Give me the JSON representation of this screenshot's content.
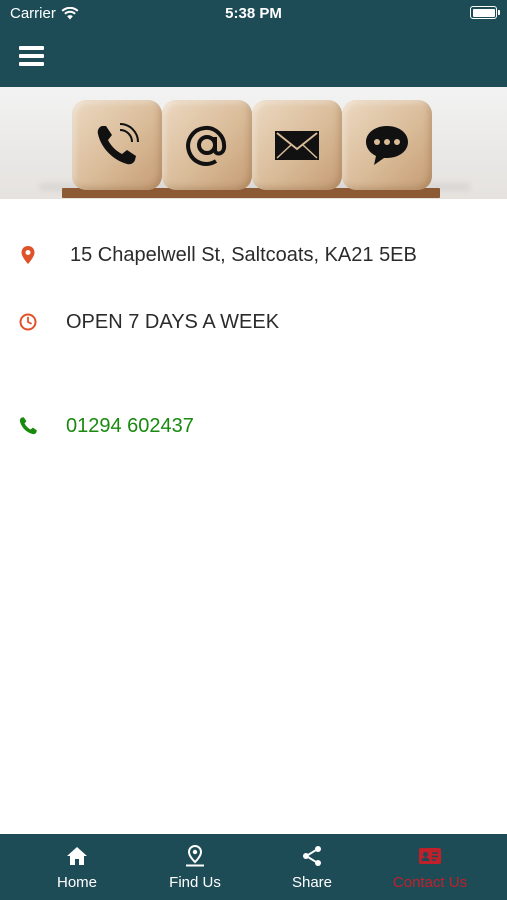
{
  "status_bar": {
    "carrier": "Carrier",
    "time": "5:38 PM",
    "wifi_icon": "wifi-icon",
    "battery_icon": "battery-icon"
  },
  "header": {
    "menu_icon": "hamburger-menu-icon",
    "background_color": "#1d4c57"
  },
  "banner": {
    "icons": [
      "phone-icon",
      "at-sign-icon",
      "envelope-icon",
      "chat-bubble-icon"
    ]
  },
  "contact": {
    "address": "15 Chapelwell St, Saltcoats, KA21 5EB",
    "address_icon": "location-pin-icon",
    "hours": "OPEN 7 DAYS A WEEK",
    "hours_icon": "clock-icon",
    "phone": "01294 602437",
    "phone_icon": "phone-icon",
    "icon_color": "#e0522a",
    "phone_color": "#1a8a0f"
  },
  "tabbar": {
    "tabs": [
      {
        "label": "Home",
        "icon": "home-icon",
        "active": false
      },
      {
        "label": "Find Us",
        "icon": "map-pin-icon",
        "active": false
      },
      {
        "label": "Share",
        "icon": "share-icon",
        "active": false
      },
      {
        "label": "Contact Us",
        "icon": "contact-card-icon",
        "active": true
      }
    ],
    "active_color": "#c0202a"
  }
}
